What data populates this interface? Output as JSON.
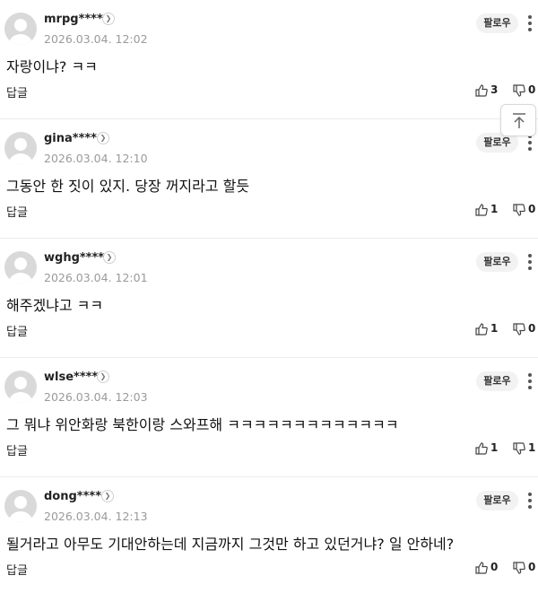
{
  "ui": {
    "follow_label": "팔로우",
    "reply_label": "답글",
    "icons": {
      "avatar": "default-user-icon",
      "profile": "chevron-right-icon",
      "more": "more-vertical-icon",
      "like": "thumbs-up-icon",
      "dislike": "thumbs-down-icon",
      "scroll_top": "arrow-up-to-top-icon"
    }
  },
  "comments": [
    {
      "username": "mrpg****",
      "date": "2026.03.04. 12:02",
      "text": "자랑이냐? ㅋㅋ",
      "likes": "3",
      "dislikes": "0"
    },
    {
      "username": "gina****",
      "date": "2026.03.04. 12:10",
      "text": "그동안 한 짓이 있지. 당장 꺼지라고 할듯",
      "likes": "1",
      "dislikes": "0"
    },
    {
      "username": "wghg****",
      "date": "2026.03.04. 12:01",
      "text": "해주겠냐고 ㅋㅋ",
      "likes": "1",
      "dislikes": "0"
    },
    {
      "username": "wlse****",
      "date": "2026.03.04. 12:03",
      "text": "그 뭐냐 위안화랑 북한이랑 스와프해 ㅋㅋㅋㅋㅋㅋㅋㅋㅋㅋㅋㅋㅋ",
      "likes": "1",
      "dislikes": "1"
    },
    {
      "username": "dong****",
      "date": "2026.03.04. 12:13",
      "text": "될거라고 아무도 기대안하는데 지금까지 그것만 하고 있던거냐? 일 안하네?",
      "likes": "0",
      "dislikes": "0"
    }
  ]
}
